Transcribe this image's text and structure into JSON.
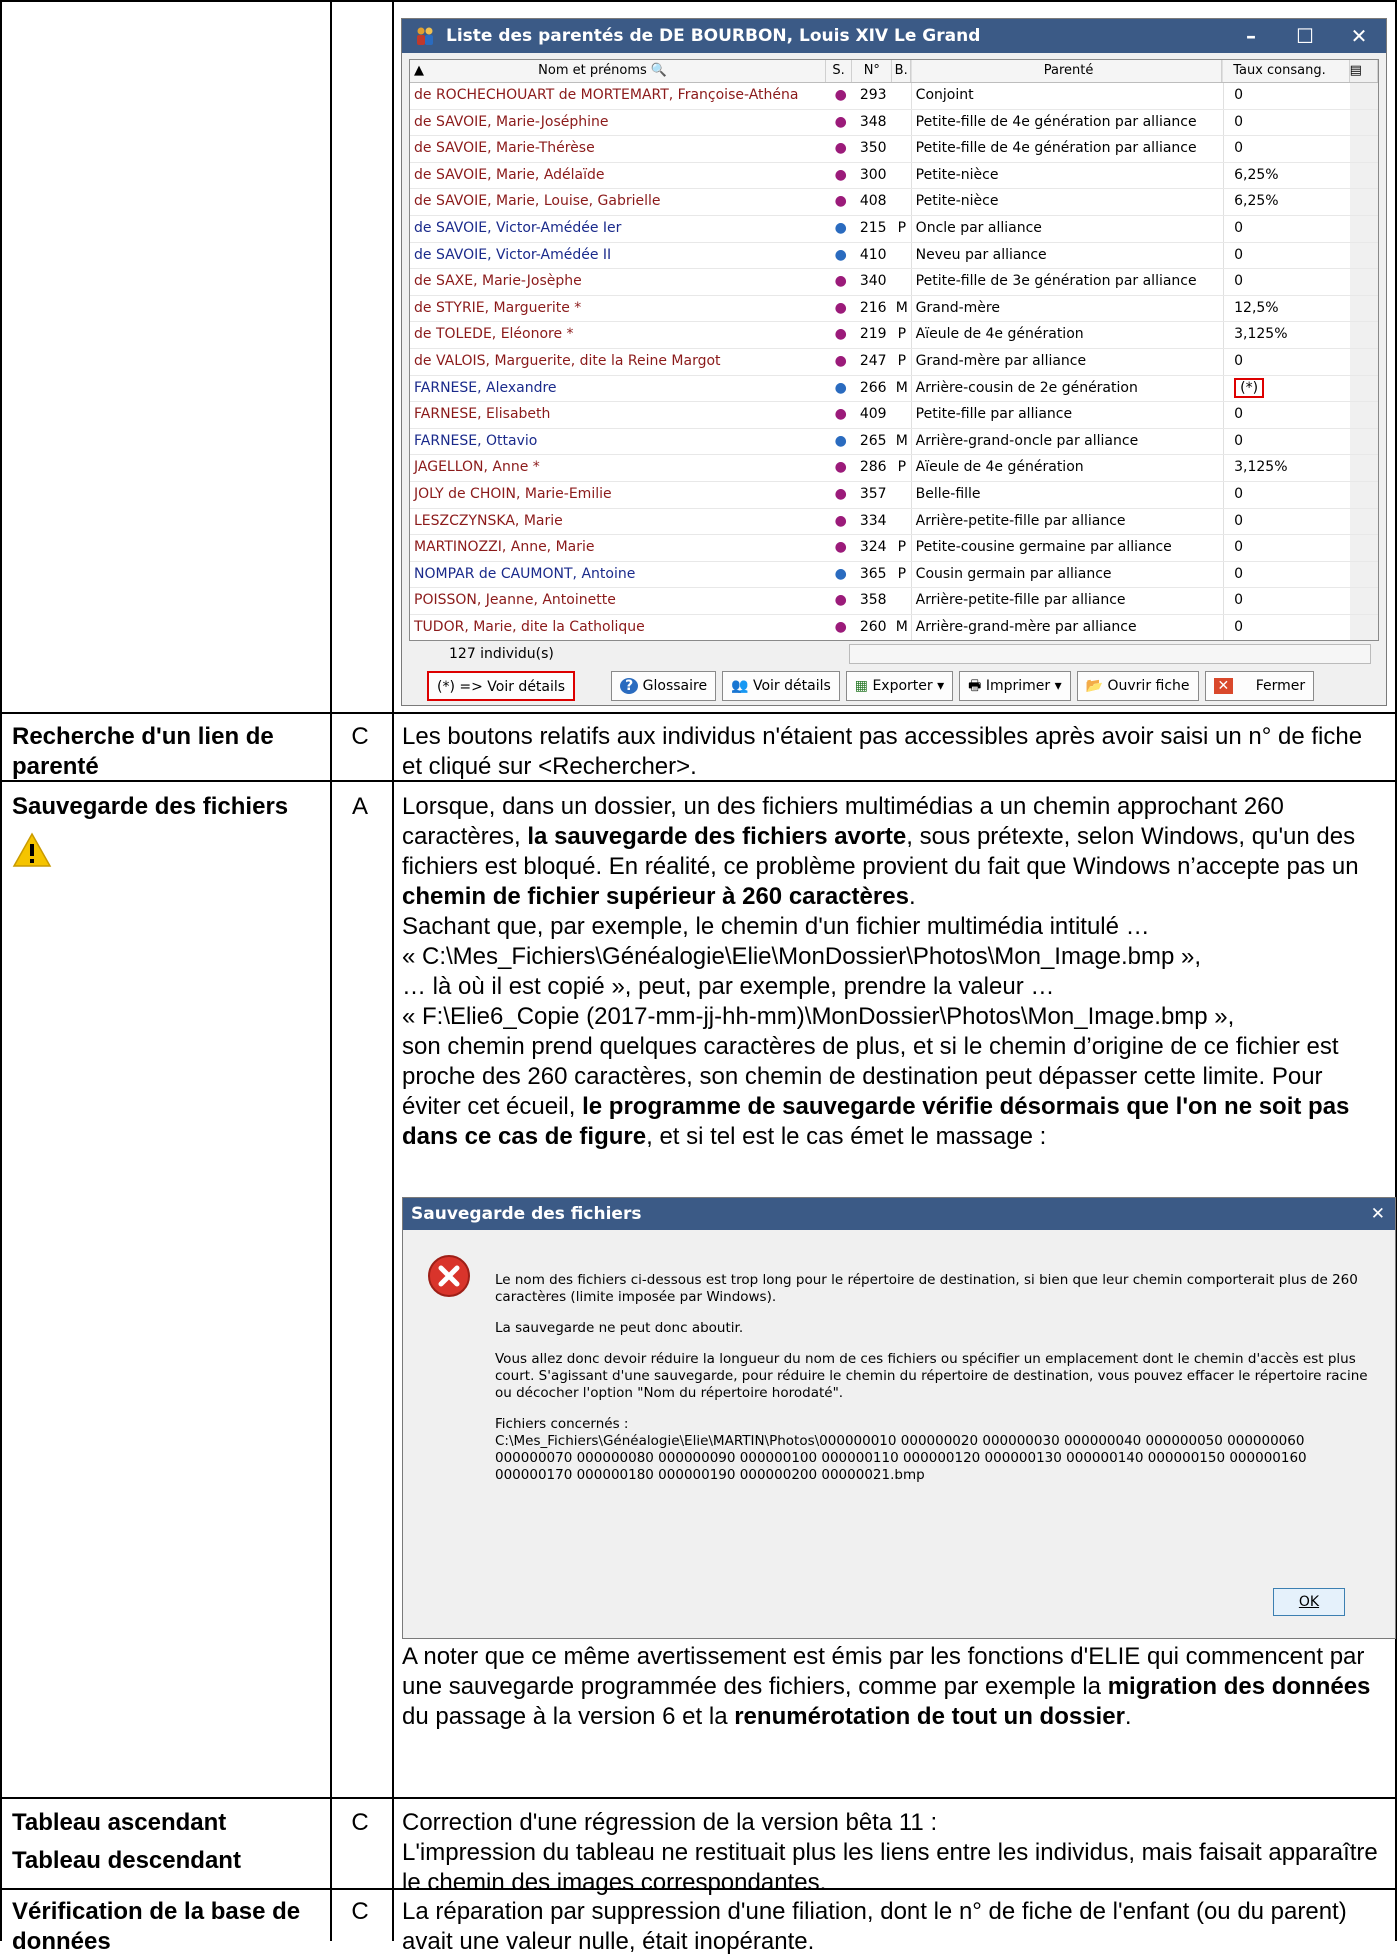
{
  "window1": {
    "title": "Liste des parentés de DE BOURBON, Louis XIV Le Grand",
    "columns": {
      "name": "Nom et prénoms",
      "sex": "S.",
      "num": "N°",
      "b": "B.",
      "parente": "Parenté",
      "taux": "Taux consang."
    },
    "rows": [
      {
        "name": "de ROCHECHOUART de MORTEMART, Françoise-Athéna",
        "sex": "F",
        "num": "293",
        "b": "",
        "parente": "Conjoint",
        "taux": "0"
      },
      {
        "name": "de SAVOIE, Marie-Joséphine",
        "sex": "F",
        "num": "348",
        "b": "",
        "parente": "Petite-fille de 4e génération par alliance",
        "taux": "0"
      },
      {
        "name": "de SAVOIE, Marie-Thérèse",
        "sex": "F",
        "num": "350",
        "b": "",
        "parente": "Petite-fille de 4e génération par alliance",
        "taux": "0"
      },
      {
        "name": "de SAVOIE, Marie, Adélaïde",
        "sex": "F",
        "num": "300",
        "b": "",
        "parente": "Petite-nièce",
        "taux": "6,25%"
      },
      {
        "name": "de SAVOIE, Marie, Louise, Gabrielle",
        "sex": "F",
        "num": "408",
        "b": "",
        "parente": "Petite-nièce",
        "taux": "6,25%"
      },
      {
        "name": "de SAVOIE, Victor-Amédée Ier",
        "sex": "M",
        "num": "215",
        "b": "P",
        "parente": "Oncle par alliance",
        "taux": "0"
      },
      {
        "name": "de SAVOIE, Victor-Amédée II",
        "sex": "M",
        "num": "410",
        "b": "",
        "parente": "Neveu par alliance",
        "taux": "0"
      },
      {
        "name": "de SAXE, Marie-Josèphe",
        "sex": "F",
        "num": "340",
        "b": "",
        "parente": "Petite-fille de 3e génération par alliance",
        "taux": "0"
      },
      {
        "name": "de STYRIE, Marguerite *",
        "sex": "F",
        "num": "216",
        "b": "M",
        "parente": "Grand-mère",
        "taux": "12,5%"
      },
      {
        "name": "de TOLEDE, Eléonore *",
        "sex": "F",
        "num": "219",
        "b": "P",
        "parente": "Aïeule de 4e génération",
        "taux": "3,125%"
      },
      {
        "name": "de VALOIS, Marguerite, dite la Reine Margot",
        "sex": "F",
        "num": "247",
        "b": "P",
        "parente": "Grand-mère par alliance",
        "taux": "0"
      },
      {
        "name": "FARNESE, Alexandre",
        "sex": "M",
        "num": "266",
        "b": "M",
        "parente": "Arrière-cousin de 2e génération",
        "taux": "(*)"
      },
      {
        "name": "FARNESE, Elisabeth",
        "sex": "F",
        "num": "409",
        "b": "",
        "parente": "Petite-fille par alliance",
        "taux": "0"
      },
      {
        "name": "FARNESE, Ottavio",
        "sex": "M",
        "num": "265",
        "b": "M",
        "parente": "Arrière-grand-oncle par alliance",
        "taux": "0"
      },
      {
        "name": "JAGELLON, Anne *",
        "sex": "F",
        "num": "286",
        "b": "P",
        "parente": "Aïeule de 4e génération",
        "taux": "3,125%"
      },
      {
        "name": "JOLY de CHOIN, Marie-Emilie",
        "sex": "F",
        "num": "357",
        "b": "",
        "parente": "Belle-fille",
        "taux": "0"
      },
      {
        "name": "LESZCZYNSKA, Marie",
        "sex": "F",
        "num": "334",
        "b": "",
        "parente": "Arrière-petite-fille par alliance",
        "taux": "0"
      },
      {
        "name": "MARTINOZZI, Anne, Marie",
        "sex": "F",
        "num": "324",
        "b": "P",
        "parente": "Petite-cousine germaine par alliance",
        "taux": "0"
      },
      {
        "name": "NOMPAR de CAUMONT, Antoine",
        "sex": "M",
        "num": "365",
        "b": "P",
        "parente": "Cousin germain par alliance",
        "taux": "0"
      },
      {
        "name": "POISSON, Jeanne, Antoinette",
        "sex": "F",
        "num": "358",
        "b": "",
        "parente": "Arrière-petite-fille par alliance",
        "taux": "0"
      },
      {
        "name": "TUDOR, Marie, dite la Catholique",
        "sex": "F",
        "num": "260",
        "b": "M",
        "parente": "Arrière-grand-mère par alliance",
        "taux": "0"
      }
    ],
    "count": "127  individu(s)",
    "buttons": {
      "details_note": "(*) => Voir détails",
      "glossaire": "Glossaire",
      "voir_details": "Voir détails",
      "exporter": "Exporter",
      "imprimer": "Imprimer",
      "ouvrir_fiche": "Ouvrir fiche",
      "fermer": "Fermer"
    }
  },
  "rows": {
    "recherche": {
      "feature": "Recherche d'un lien de parenté",
      "code": "C",
      "text": "Les boutons relatifs aux individus n'étaient pas accessibles après avoir saisi un n° de fiche et cliqué sur <Rechercher>."
    },
    "sauvegarde": {
      "feature": "Sauvegarde des fichiers",
      "code": "A",
      "p1a": "Lorsque, dans un dossier, un des fichiers multimédias a un chemin approchant 260 caractères, ",
      "p1b": "la sauvegarde des fichiers avorte",
      "p1c": ", sous prétexte, selon Windows, qu'un des fichiers est bloqué. En réalité, ce problème provient du fait que Windows n’accepte pas un ",
      "p1d": "chemin de fichier supérieur à 260 caractères",
      "p1e": ".",
      "p2": "Sachant que, par exemple, le chemin d'un fichier multimédia intitulé …",
      "p3": "« C:\\Mes_Fichiers\\Généalogie\\Elie\\MonDossier\\Photos\\Mon_Image.bmp »,",
      "p4": "… là où il est copié », peut, par exemple, prendre la valeur …",
      "p5": "« F:\\Elie6_Copie (2017-mm-jj-hh-mm)\\MonDossier\\Photos\\Mon_Image.bmp »,",
      "p6a": "son chemin prend quelques caractères de plus, et si le chemin d’origine de ce fichier est proche des 260 caractères, son chemin de destination peut dépasser cette limite. Pour éviter cet écueil, ",
      "p6b": "le programme de sauvegarde vérifie désormais que l'on ne soit pas dans ce cas de figure",
      "p6c": ", et si tel est le cas émet le massage :",
      "after_a": "A noter que ce même avertissement est émis par les fonctions d'ELIE qui commencent par une sauvegarde programmée des fichiers, comme par exemple la ",
      "after_b": "migration des données",
      "after_c": " du passage à la version 6 et la ",
      "after_d": "renumérotation de tout un dossier",
      "after_e": "."
    },
    "tableau": {
      "feature1": "Tableau ascendant",
      "feature2": "Tableau descendant",
      "code": "C",
      "line1": "Correction d'une régression de la version bêta 11 :",
      "line2": "L'impression du tableau ne restituait plus les liens entre les individus, mais faisait apparaître le chemin des images correspondantes."
    },
    "verification": {
      "feature": "Vérification de la base de données",
      "code": "C",
      "text": "La réparation par suppression d'une filiation, dont le n° de fiche de l'enfant (ou du parent) avait une valeur nulle, était inopérante."
    }
  },
  "dialog": {
    "title": "Sauvegarde des fichiers",
    "msg1": "Le nom des fichiers ci-dessous est trop long pour le répertoire de destination, si bien que leur chemin comporterait plus de 260 caractères (limite imposée par Windows).",
    "msg2": "La sauvegarde ne peut donc aboutir.",
    "msg3": "Vous allez donc devoir réduire la longueur du nom de ces fichiers ou spécifier un emplacement dont le chemin d'accès est plus court. S'agissant d'une sauvegarde, pour réduire le chemin du répertoire de destination, vous pouvez effacer le répertoire racine ou décocher l'option \"Nom du répertoire horodaté\".",
    "msg4a": "Fichiers concernés :",
    "msg4b": "C:\\Mes_Fichiers\\Généalogie\\Elie\\MARTIN\\Photos\\000000010 000000020 000000030 000000040 000000050 000000060 000000070 000000080 000000090 000000100 000000110 000000120 000000130 000000140 000000150 000000160 000000170 000000180 000000190 000000200 00000021.bmp",
    "ok": "OK"
  }
}
